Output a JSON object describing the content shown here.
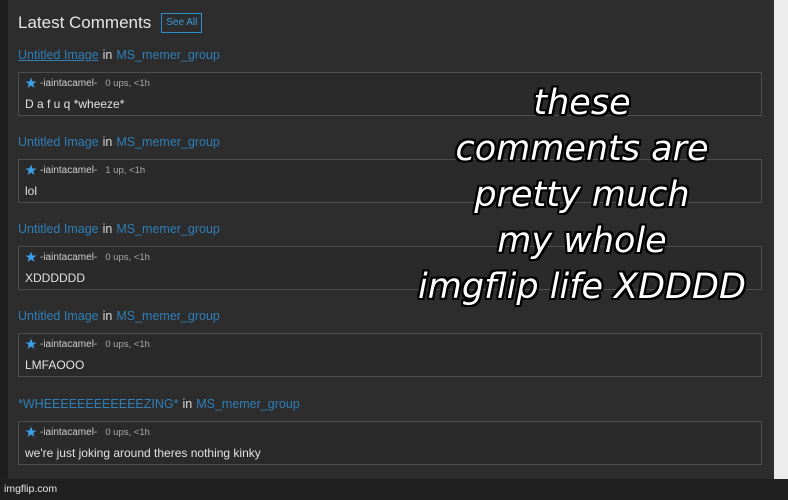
{
  "header": {
    "title": "Latest Comments",
    "see_all": "See All"
  },
  "connector": "in",
  "groups": [
    {
      "post": "Untitled Image",
      "group": "MS_memer_group",
      "user": "-iaintacamel-",
      "stats": "0 ups, <1h",
      "text": "D a f u q *wheeze*"
    },
    {
      "post": "Untitled Image",
      "group": "MS_memer_group",
      "user": "-iaintacamel-",
      "stats": "1 up, <1h",
      "text": "lol"
    },
    {
      "post": "Untitled Image",
      "group": "MS_memer_group",
      "user": "-iaintacamel-",
      "stats": "0 ups, <1h",
      "text": "XDDDDDD"
    },
    {
      "post": "Untitled Image",
      "group": "MS_memer_group",
      "user": "-iaintacamel-",
      "stats": "0 ups, <1h",
      "text": "LMFAOOO"
    },
    {
      "post": "*WHEEEEEEEEEEEEZING*",
      "group": "MS_memer_group",
      "user": "-iaintacamel-",
      "stats": "0 ups, <1h",
      "text": "we're just joking around theres nothing kinky"
    }
  ],
  "overlay": {
    "lines": [
      "these",
      "comments are",
      "pretty much",
      "my whole",
      "imgflip life XDDDD"
    ]
  },
  "watermark": "imgflip.com",
  "colors": {
    "link": "#2f7fb8",
    "accent": "#2b8fd0",
    "star": "#3aa0e8",
    "background": "#2c2c2c"
  }
}
